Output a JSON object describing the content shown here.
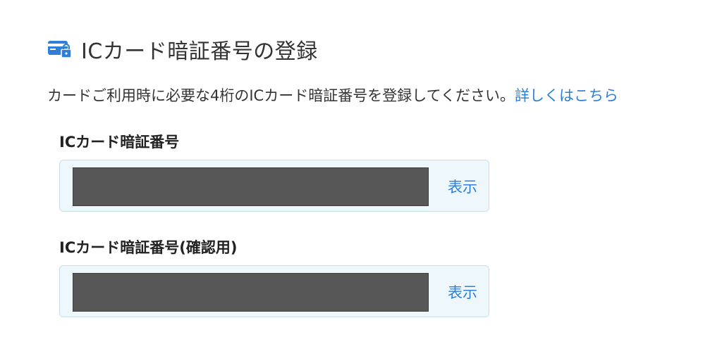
{
  "header": {
    "title": "ICカード暗証番号の登録",
    "icon": "ic-card-lock-icon",
    "icon_color": "#2f7fd8"
  },
  "intro": {
    "text": "カードご利用時に必要な4桁のICカード暗証番号を登録してください。",
    "link_label": "詳しくはこちら"
  },
  "fields": [
    {
      "label": "ICカード暗証番号",
      "value": "",
      "show_label": "表示"
    },
    {
      "label": "ICカード暗証番号(確認用)",
      "value": "",
      "show_label": "表示"
    }
  ],
  "colors": {
    "link": "#2f7fd8",
    "field_background": "#eef8fc",
    "masked_input": "#575757"
  }
}
